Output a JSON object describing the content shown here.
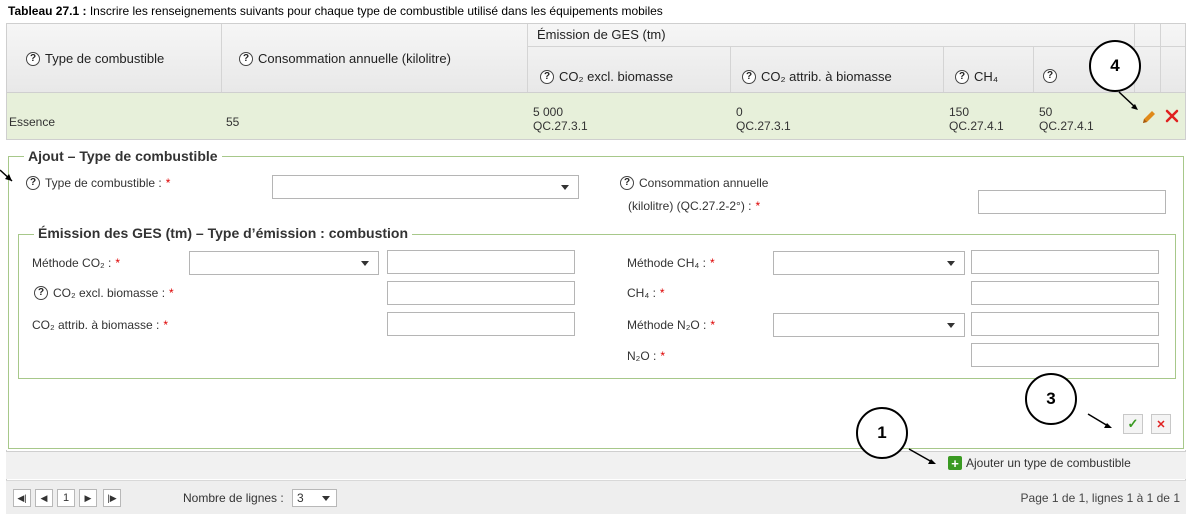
{
  "caption": {
    "bold": "Tableau 27.1 :",
    "text": " Inscrire les renseignements suivants pour chaque type de combustible utilisé dans les équipements mobiles"
  },
  "header": {
    "type": "Type de combustible",
    "consommation": "Consommation annuelle (kilolitre)",
    "emission_group": "Émission de GES (tm)",
    "co2_excl": "CO₂ excl. biomasse",
    "co2_attr": "CO₂ attrib. à biomasse",
    "ch4": "CH₄",
    "help_glyph": "?"
  },
  "row": {
    "type": "Essence",
    "consommation": "55",
    "co2_excl_value": "5 000",
    "co2_excl_ref": "QC.27.3.1",
    "co2_attr_value": "0",
    "co2_attr_ref": "QC.27.3.1",
    "ch4_value": "150",
    "ch4_ref": "QC.27.4.1",
    "n2o_value": "50",
    "n2o_ref": "QC.27.4.1",
    "edit_icon": "pencil-icon",
    "delete_icon": "delete-x-icon"
  },
  "form": {
    "legend": "Ajout – Type de combustible",
    "type_label": "Type de combustible :",
    "required_mark": "*",
    "type_value": "",
    "consommation_label_line1": "Consommation annuelle",
    "consommation_label_line2": "(kilolitre) (QC.27.2-2°) :",
    "consommation_value": "",
    "emission_legend": "Émission des GES (tm) – Type d’émission : combustion",
    "methode_co2_label": "Méthode CO₂ :",
    "co2_excl_label": "CO₂ excl. biomasse :",
    "co2_attr_label": "CO₂ attrib. à biomasse :",
    "methode_ch4_label": "Méthode CH₄ :",
    "ch4_label": "CH₄ :",
    "methode_n2o_label": "Méthode N₂O :",
    "n2o_label": "N₂O :",
    "confirm_glyph": "✓",
    "cancel_glyph": "✕"
  },
  "add_button": {
    "label": "Ajouter un type de combustible",
    "icon": "plus-icon",
    "glyph": "+"
  },
  "pagination": {
    "first": "first-page-icon",
    "prev": "prev-page-icon",
    "current_page": "1",
    "next": "next-page-icon",
    "last": "last-page-icon",
    "rows_label": "Nombre de lignes :",
    "rows_value": "3",
    "summary": "Page 1 de 1, lignes 1 à 1 de 1"
  },
  "callouts": {
    "c1": "1",
    "c3": "3",
    "c4": "4"
  },
  "colors": {
    "row_highlight": "#e7f0da",
    "fieldset_border": "#a7c88a",
    "required": "#dd0000",
    "edit_pencil": "#e08a1a",
    "delete": "#e02020",
    "confirm": "#3a9a22",
    "add_icon": "#3a9a22"
  }
}
